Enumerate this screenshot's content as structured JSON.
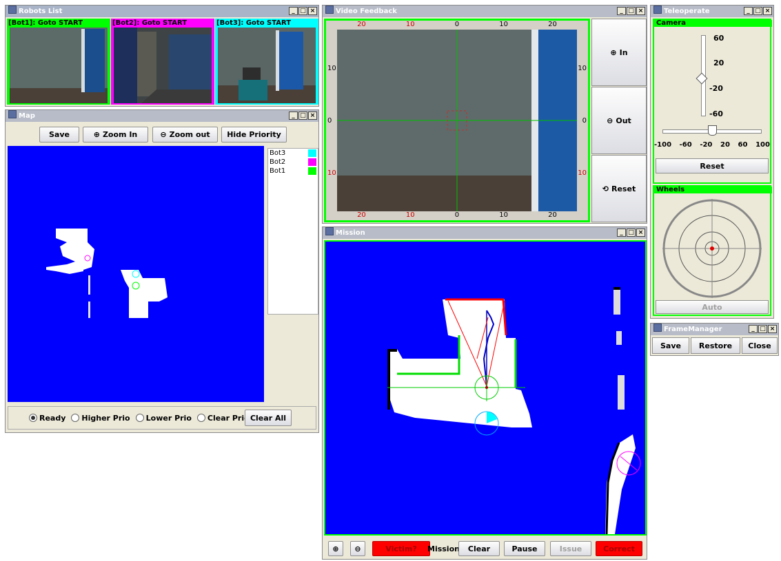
{
  "robots_list": {
    "title": "Robots List",
    "cameras": [
      {
        "label": "[Bot1]: Goto START",
        "color": "#00ff00"
      },
      {
        "label": "[Bot2]: Goto START",
        "color": "#ff00ff"
      },
      {
        "label": "[Bot3]: Goto START",
        "color": "#00ffff"
      }
    ]
  },
  "map": {
    "title": "Map",
    "buttons": {
      "save": "Save",
      "zoom_in": "Zoom In",
      "zoom_out": "Zoom out",
      "hide_priority": "Hide Priority"
    },
    "legend": [
      {
        "name": "Bot3",
        "color": "#00ffff"
      },
      {
        "name": "Bot2",
        "color": "#ff00ff"
      },
      {
        "name": "Bot1",
        "color": "#00ff00"
      }
    ],
    "priority": {
      "options": [
        "Ready",
        "Higher Prio",
        "Lower Prio",
        "Clear Prio"
      ],
      "selected": "Ready",
      "clear_all": "Clear All"
    },
    "map_color": "#0000ff"
  },
  "video": {
    "title": "Video Feedback",
    "top_ticks": [
      "20",
      "10",
      "0",
      "10",
      "20"
    ],
    "bottom_ticks": [
      "20",
      "10",
      "0",
      "10",
      "20"
    ],
    "left_ticks": [
      "10",
      "0",
      "10"
    ],
    "right_ticks": [
      "10",
      "0",
      "10"
    ],
    "buttons": {
      "in": "In",
      "out": "Out",
      "reset": "Reset"
    }
  },
  "mission": {
    "title": "Mission",
    "buttons": {
      "victim": "Victim?",
      "clear": "Clear",
      "pause": "Pause",
      "issue": "Issue",
      "correct": "Correct"
    },
    "mission_label": "Mission"
  },
  "teleoperate": {
    "title": "Teleoperate",
    "camera_label": "Camera",
    "vertical_ticks": [
      "60",
      "20",
      "-20",
      "-60"
    ],
    "horizontal_ticks": [
      "-100",
      "-60",
      "-20",
      "20",
      "60",
      "100"
    ],
    "reset": "Reset",
    "wheels_label": "Wheels",
    "auto": "Auto"
  },
  "frame_manager": {
    "title": "FrameManager",
    "buttons": {
      "save": "Save",
      "restore": "Restore",
      "close": "Close"
    }
  }
}
